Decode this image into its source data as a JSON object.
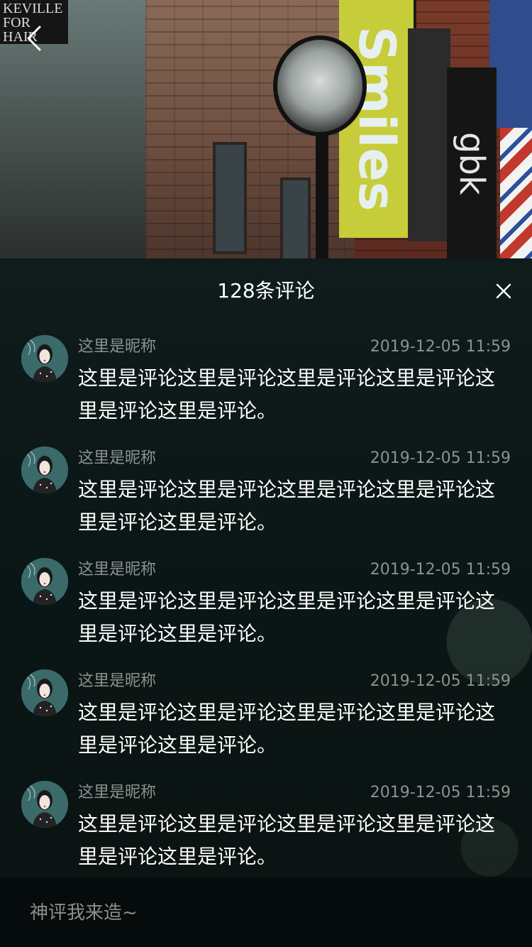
{
  "header": {
    "back_icon": "chevron-left-icon",
    "sign_text": "KEVILLE\nFOR\nHAIR",
    "banner_text": "Smiles",
    "side_banner_text": "gbk"
  },
  "comments_panel": {
    "title": "128条评论",
    "close_icon": "close-icon"
  },
  "comments": [
    {
      "nickname": "这里是昵称",
      "time": "2019-12-05 11:59",
      "content": "这里是评论这里是评论这里是评论这里是评论这里是评论这里是评论。"
    },
    {
      "nickname": "这里是昵称",
      "time": "2019-12-05 11:59",
      "content": "这里是评论这里是评论这里是评论这里是评论这里是评论这里是评论。"
    },
    {
      "nickname": "这里是昵称",
      "time": "2019-12-05 11:59",
      "content": "这里是评论这里是评论这里是评论这里是评论这里是评论这里是评论。"
    },
    {
      "nickname": "这里是昵称",
      "time": "2019-12-05 11:59",
      "content": "这里是评论这里是评论这里是评论这里是评论这里是评论这里是评论。"
    },
    {
      "nickname": "这里是昵称",
      "time": "2019-12-05 11:59",
      "content": "这里是评论这里是评论这里是评论这里是评论这里是评论这里是评论。"
    }
  ],
  "input": {
    "placeholder": "神评我来造~"
  },
  "colors": {
    "sheet_bg": "#0f1c1b",
    "meta_text": "#8b9290",
    "content_text": "#ffffff",
    "banner": "#c7cc3a"
  }
}
